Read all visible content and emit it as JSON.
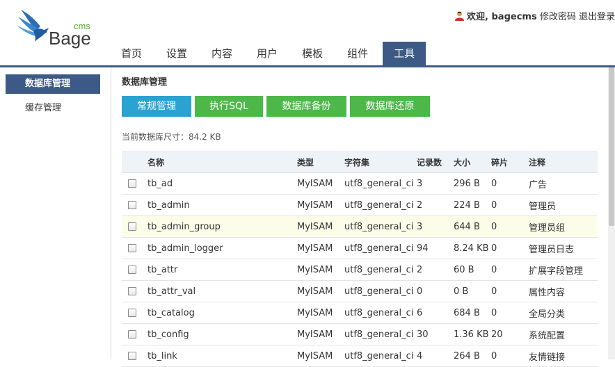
{
  "logo": {
    "brand": "Bage",
    "suffix": "cms"
  },
  "userbar": {
    "welcome": "欢迎, bagecms",
    "change_password": "修改密码",
    "logout": "退出登录"
  },
  "nav": [
    "首页",
    "设置",
    "内容",
    "用户",
    "模板",
    "组件",
    "工具"
  ],
  "nav_active": "工具",
  "sidebar": {
    "items": [
      "数据库管理",
      "缓存管理"
    ]
  },
  "main": {
    "title": "数据库管理",
    "buttons": [
      "常规管理",
      "执行SQL",
      "数据库备份",
      "数据库还原"
    ],
    "db_size": "当前数据库尺寸：84.2 KB"
  },
  "table": {
    "columns": [
      "名称",
      "类型",
      "字符集",
      "记录数",
      "大小",
      "碎片",
      "注释"
    ],
    "rows": [
      {
        "name": "tb_ad",
        "type": "MyISAM",
        "charset": "utf8_general_ci",
        "rows": "3",
        "size": "296 B",
        "frag": "0",
        "comment": "广告"
      },
      {
        "name": "tb_admin",
        "type": "MyISAM",
        "charset": "utf8_general_ci",
        "rows": "2",
        "size": "224 B",
        "frag": "0",
        "comment": "管理员"
      },
      {
        "name": "tb_admin_group",
        "type": "MyISAM",
        "charset": "utf8_general_ci",
        "rows": "3",
        "size": "644 B",
        "frag": "0",
        "comment": "管理员组"
      },
      {
        "name": "tb_admin_logger",
        "type": "MyISAM",
        "charset": "utf8_general_ci",
        "rows": "94",
        "size": "8.24 KB",
        "frag": "0",
        "comment": "管理员日志"
      },
      {
        "name": "tb_attr",
        "type": "MyISAM",
        "charset": "utf8_general_ci",
        "rows": "2",
        "size": "60 B",
        "frag": "0",
        "comment": "扩展字段管理"
      },
      {
        "name": "tb_attr_val",
        "type": "MyISAM",
        "charset": "utf8_general_ci",
        "rows": "0",
        "size": "0 B",
        "frag": "0",
        "comment": "属性内容"
      },
      {
        "name": "tb_catalog",
        "type": "MyISAM",
        "charset": "utf8_general_ci",
        "rows": "6",
        "size": "684 B",
        "frag": "0",
        "comment": "全局分类"
      },
      {
        "name": "tb_config",
        "type": "MyISAM",
        "charset": "utf8_general_ci",
        "rows": "30",
        "size": "1.36 KB",
        "frag": "20",
        "comment": "系统配置"
      },
      {
        "name": "tb_link",
        "type": "MyISAM",
        "charset": "utf8_general_ci",
        "rows": "4",
        "size": "264 B",
        "frag": "0",
        "comment": "友情链接"
      }
    ]
  },
  "colors": {
    "nav_active": "#3c5a85",
    "button_blue": "#2aa3d0",
    "button_green": "#4db849",
    "row_highlight": "#fbfde9"
  },
  "icons": {
    "logo": "bird-logo-icon",
    "user": "user-icon",
    "checkbox": "checkbox-icon"
  }
}
